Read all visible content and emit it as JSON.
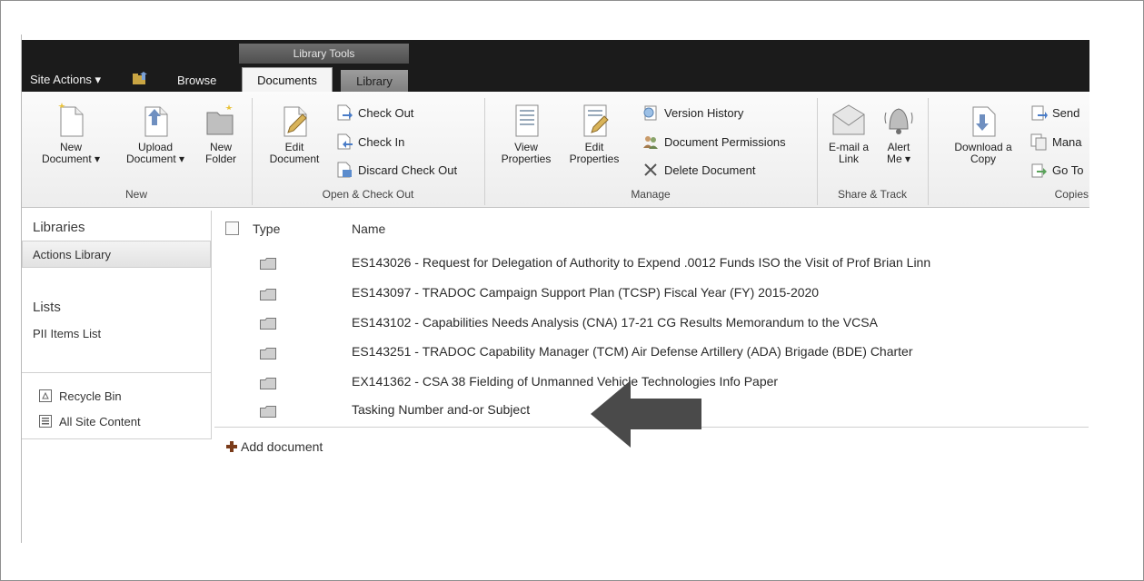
{
  "ribbon_context": "Library Tools",
  "topbar": {
    "site_actions": "Site Actions ▾",
    "browse": "Browse",
    "tabs": [
      "Documents",
      "Library"
    ]
  },
  "ribbon": {
    "groups": {
      "new": {
        "label": "New",
        "new_document": [
          "New",
          "Document ▾"
        ],
        "upload_document": [
          "Upload",
          "Document ▾"
        ],
        "new_folder": [
          "New",
          "Folder"
        ]
      },
      "open_checkout": {
        "label": "Open & Check Out",
        "edit_document": [
          "Edit",
          "Document"
        ],
        "check_out": "Check Out",
        "check_in": "Check In",
        "discard_check_out": "Discard Check Out"
      },
      "manage": {
        "label": "Manage",
        "view_properties": [
          "View",
          "Properties"
        ],
        "edit_properties": [
          "Edit",
          "Properties"
        ],
        "version_history": "Version History",
        "document_permissions": "Document Permissions",
        "delete_document": "Delete Document"
      },
      "share_track": {
        "label": "Share & Track",
        "email_link": [
          "E-mail a",
          "Link"
        ],
        "alert_me": [
          "Alert",
          "Me ▾"
        ]
      },
      "copies": {
        "label": "Copies",
        "download_copy": [
          "Download a",
          "Copy"
        ],
        "send_to": "Send",
        "manage_copies": "Mana",
        "go_to_source": "Go To"
      }
    }
  },
  "leftnav": {
    "libraries_heading": "Libraries",
    "libraries": [
      "Actions Library"
    ],
    "lists_heading": "Lists",
    "lists": [
      "PII Items List"
    ],
    "recycle_bin": "Recycle Bin",
    "all_site_content": "All Site Content"
  },
  "list": {
    "columns": [
      "Type",
      "Name"
    ],
    "rows": [
      "ES143026 - Request for Delegation of Authority to Expend .0012 Funds ISO the Visit of Prof Brian Linn",
      "ES143097 - TRADOC Campaign Support Plan (TCSP) Fiscal Year (FY) 2015-2020",
      "ES143102 - Capabilities Needs Analysis (CNA) 17-21 CG Results Memorandum to the VCSA",
      "ES143251 - TRADOC Capability Manager (TCM) Air Defense Artillery (ADA) Brigade (BDE) Charter",
      "EX141362 - CSA 38 Fielding of Unmanned Vehicle Technologies Info Paper",
      "Tasking Number and-or Subject"
    ],
    "add_document": "Add document"
  },
  "colors": {
    "topbar": "#1b1b1b",
    "arrow": "#4a4a4a"
  }
}
